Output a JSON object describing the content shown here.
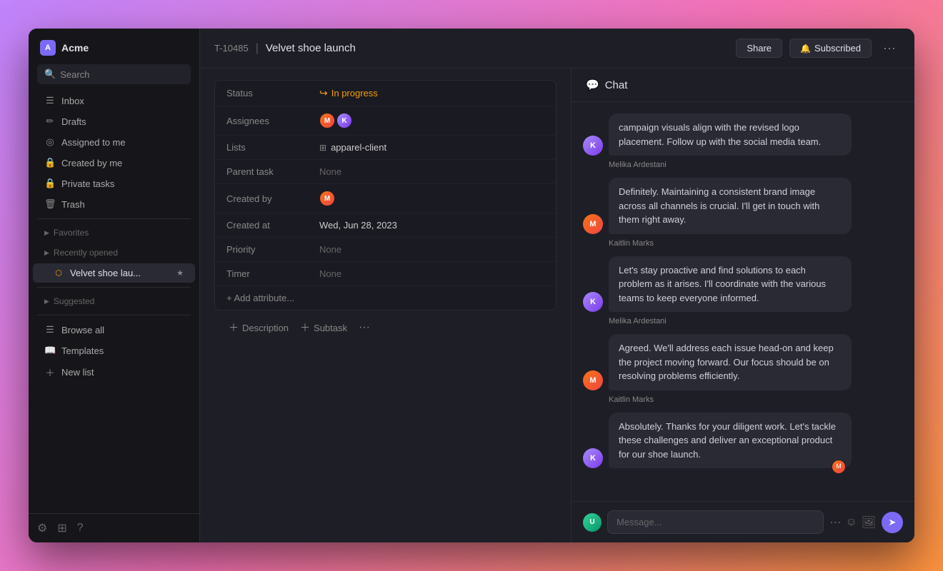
{
  "workspace": {
    "avatar_letter": "A",
    "name": "Acme"
  },
  "search": {
    "placeholder": "Search"
  },
  "sidebar": {
    "nav_items": [
      {
        "id": "inbox",
        "label": "Inbox",
        "icon": "☰"
      },
      {
        "id": "drafts",
        "label": "Drafts",
        "icon": "✏"
      },
      {
        "id": "assigned",
        "label": "Assigned to me",
        "icon": "◎"
      },
      {
        "id": "created",
        "label": "Created by me",
        "icon": "🔒"
      },
      {
        "id": "private",
        "label": "Private tasks",
        "icon": "🔒"
      },
      {
        "id": "trash",
        "label": "Trash",
        "icon": "🗑"
      }
    ],
    "sections": [
      {
        "id": "favorites",
        "label": "Favorites"
      },
      {
        "id": "recently_opened",
        "label": "Recently opened"
      }
    ],
    "recently_opened_items": [
      {
        "id": "velvet",
        "label": "Velvet shoe lau...",
        "active": true
      }
    ],
    "suggested_label": "Suggested",
    "browse_all": "Browse all",
    "templates": "Templates",
    "new_list": "New list"
  },
  "header": {
    "task_id": "T-10485",
    "task_title": "Velvet shoe launch",
    "share_label": "Share",
    "subscribed_label": "Subscribed"
  },
  "task": {
    "attributes": [
      {
        "label": "Status",
        "value": "In progress",
        "type": "status"
      },
      {
        "label": "Assignees",
        "value": "",
        "type": "avatars"
      },
      {
        "label": "Lists",
        "value": "apparel-client",
        "type": "list"
      },
      {
        "label": "Parent task",
        "value": "None",
        "type": "text"
      },
      {
        "label": "Created by",
        "value": "",
        "type": "avatar_single"
      },
      {
        "label": "Created at",
        "value": "Wed, Jun 28, 2023",
        "type": "text"
      },
      {
        "label": "Priority",
        "value": "None",
        "type": "text"
      },
      {
        "label": "Timer",
        "value": "None",
        "type": "text"
      }
    ],
    "add_attribute_label": "+ Add attribute..."
  },
  "actions": {
    "description_label": "Description",
    "subtask_label": "Subtask"
  },
  "chat": {
    "title": "Chat",
    "messages": [
      {
        "id": 1,
        "sender": "Kaitlin Marks",
        "avatar_class": "msg-av2",
        "text": "campaign visuals align with the revised logo placement. Follow up with the social media team.",
        "sender_label": "Melika Ardestani"
      },
      {
        "id": 2,
        "sender": "Melika Ardestani",
        "avatar_class": "msg-av1",
        "text": "Definitely. Maintaining a consistent brand image across all channels is crucial. I'll get in touch with them right away.",
        "sender_label": "Kaitlin Marks"
      },
      {
        "id": 3,
        "sender": "Kaitlin Marks",
        "avatar_class": "msg-av2",
        "text": "Let's stay proactive and find solutions to each problem as it arises. I'll coordinate with the various teams to keep everyone informed.",
        "sender_label": "Melika Ardestani"
      },
      {
        "id": 4,
        "sender": "Melika Ardestani",
        "avatar_class": "msg-av1",
        "text": "Agreed. We'll address each issue head-on and keep the project moving forward. Our focus should be on resolving problems efficiently.",
        "sender_label": "Kaitlin Marks"
      },
      {
        "id": 5,
        "sender": "Kaitlin Marks",
        "avatar_class": "msg-av2",
        "text": "Absolutely. Thanks for your diligent work. Let's tackle these challenges and deliver an exceptional product for our shoe launch.",
        "sender_label": ""
      }
    ],
    "input_placeholder": "Message..."
  }
}
